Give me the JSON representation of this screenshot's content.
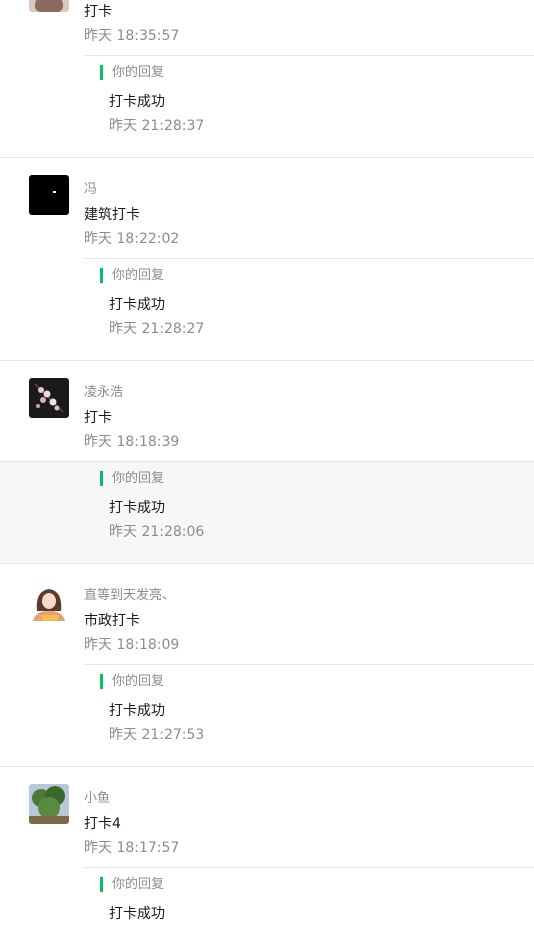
{
  "reply_label": "你的回复",
  "entries": [
    {
      "name": "",
      "message": "打卡",
      "time": "昨天 18:35:57",
      "reply_text": "打卡成功",
      "reply_time": "昨天 21:28:37",
      "avatar_icon": "user-photo-icon"
    },
    {
      "name": "冯",
      "message": "建筑打卡",
      "time": "昨天 18:22:02",
      "reply_text": "打卡成功",
      "reply_time": "昨天 21:28:27",
      "avatar_icon": "black-avatar-icon"
    },
    {
      "name": "凌永浩",
      "message": "打卡",
      "time": "昨天 18:18:39",
      "reply_text": "打卡成功",
      "reply_time": "昨天 21:28:06",
      "avatar_icon": "flower-avatar-icon"
    },
    {
      "name": "直等到天发亮、",
      "message": "市政打卡",
      "time": "昨天 18:18:09",
      "reply_text": "打卡成功",
      "reply_time": "昨天 21:27:53",
      "avatar_icon": "girl-avatar-icon"
    },
    {
      "name": "小鱼",
      "message": "打卡4",
      "time": "昨天 18:17:57",
      "reply_text": "打卡成功",
      "reply_time": "",
      "avatar_icon": "tree-avatar-icon"
    }
  ]
}
